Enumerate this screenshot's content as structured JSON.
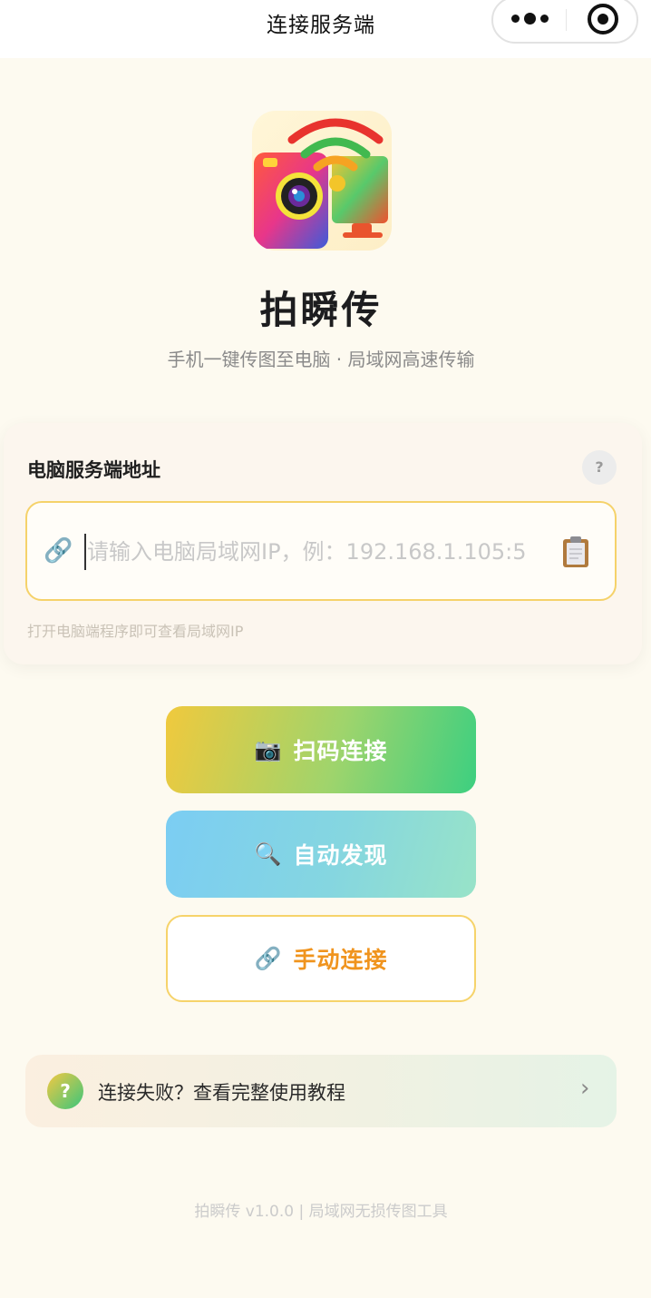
{
  "nav": {
    "title": "连接服务端"
  },
  "header": {
    "app_name": "拍瞬传",
    "tagline": "手机一键传图至电脑 · 局域网高速传输"
  },
  "server_card": {
    "title": "电脑服务端地址",
    "help_label": "?",
    "input": {
      "value": "",
      "placeholder": "请输入电脑局域网IP，例：192.168.1.105:5",
      "link_icon": "🔗"
    },
    "hint": "打开电脑端程序即可查看局域网IP"
  },
  "buttons": {
    "scan": {
      "icon": "📷",
      "label": "扫码连接"
    },
    "auto": {
      "icon": "🔍",
      "label": "自动发现"
    },
    "manual": {
      "icon": "🔗",
      "label": "手动连接"
    }
  },
  "tutorial": {
    "icon": "?",
    "text": "连接失败？查看完整使用教程",
    "chevron": "›"
  },
  "footer": {
    "text": "拍瞬传 v1.0.0 | 局域网无损传图工具"
  },
  "colors": {
    "accent_yellow": "#f5d26a",
    "accent_orange": "#f0941e",
    "accent_green": "#3dcf80",
    "accent_blue": "#7bcdf3",
    "background": "#fdfaf0"
  }
}
